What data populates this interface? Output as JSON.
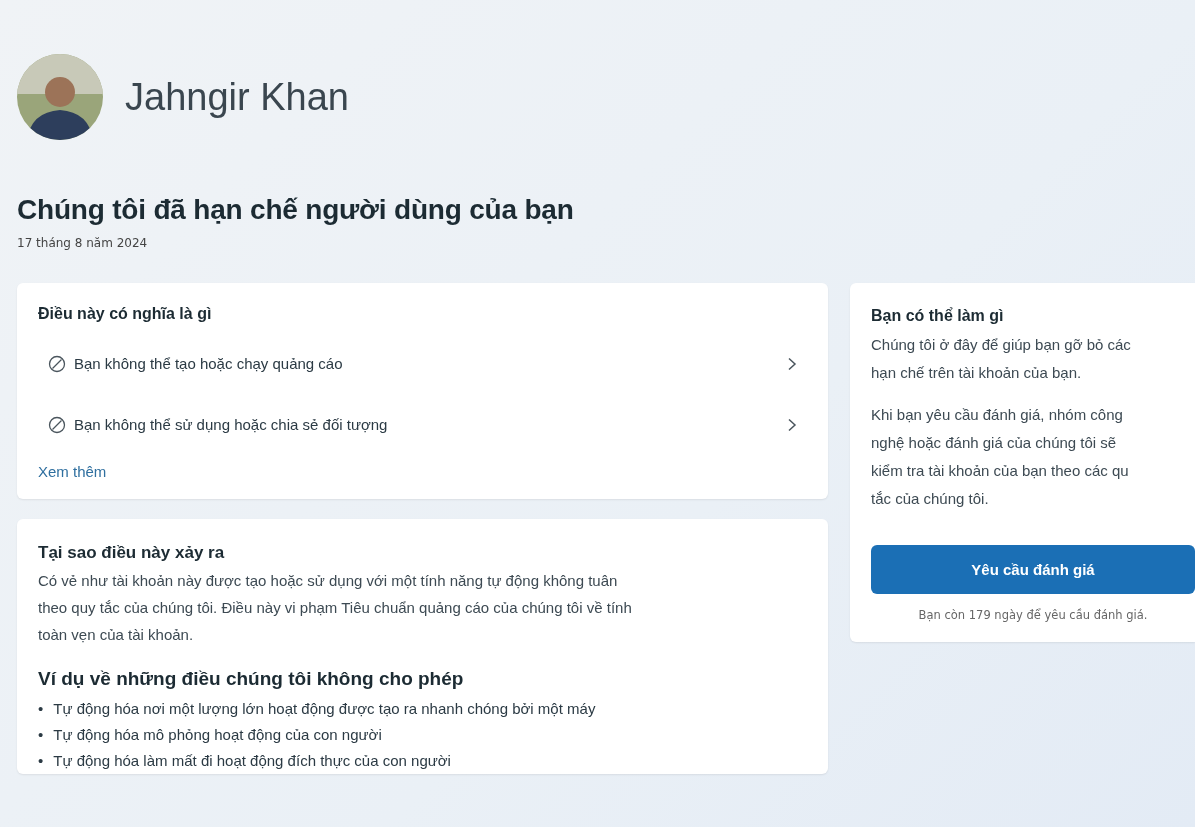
{
  "profile": {
    "name": "Jahngir Khan"
  },
  "heading": {
    "title": "Chúng tôi đã hạn chế người dùng của bạn",
    "date": "17 tháng 8 năm 2024"
  },
  "meaning_card": {
    "title": "Điều này có nghĩa là gì",
    "items": [
      {
        "label": "Bạn không thể tạo hoặc chạy quảng cáo"
      },
      {
        "label": "Bạn không thể sử dụng hoặc chia sẻ đối tượng"
      }
    ],
    "link": "Xem thêm"
  },
  "reason_card": {
    "title": "Tại sao điều này xảy ra",
    "lines": [
      "Có vẻ như tài khoản này được tạo hoặc sử dụng với một tính năng tự động không tuân",
      "theo quy tắc của chúng tôi. Điều này vi phạm Tiêu chuẩn quảng cáo của chúng tôi về tính",
      "toàn vẹn của tài khoản."
    ],
    "examples_title": "Ví dụ về những điều chúng tôi không cho phép",
    "examples": [
      {
        "marker": "•",
        "text": "Tự động hóa nơi một lượng lớn hoạt động được tạo ra nhanh chóng bởi một máy"
      },
      {
        "marker": "•",
        "text": "Tự động hóa mô phỏng hoạt động của con người"
      },
      {
        "marker": "•",
        "text": "Tự động hóa làm mất đi hoạt động đích thực của con người"
      }
    ]
  },
  "action_card": {
    "title": "Bạn có thể làm gì",
    "paragraphs": [
      [
        "Chúng tôi ở đây để giúp bạn gỡ bỏ các",
        "hạn chế trên tài khoản của bạn."
      ],
      [
        "Khi bạn yêu cầu đánh giá, nhóm công",
        "nghệ hoặc đánh giá của chúng tôi sẽ",
        "kiểm tra tài khoản của bạn theo các qu",
        "tắc của chúng tôi."
      ]
    ],
    "button": "Yêu cầu đánh giá",
    "note": "Bạn còn 179 ngày để yêu cầu đánh giá."
  }
}
